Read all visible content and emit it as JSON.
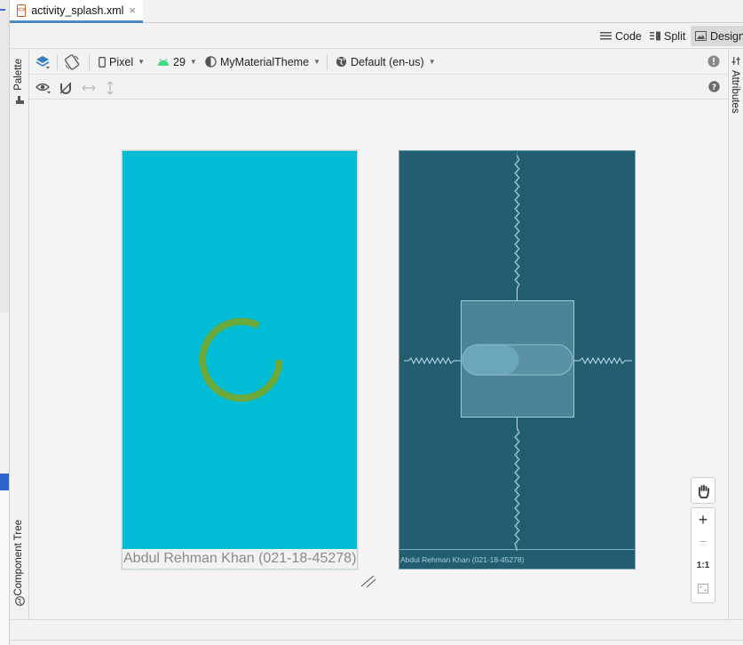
{
  "editor_tab": {
    "file_icon": "xml-file-icon",
    "file_icon_text": "<>",
    "filename": "activity_splash.xml",
    "close_glyph": "×"
  },
  "mode_bar": {
    "code_label": "Code",
    "split_label": "Split",
    "design_label": "Design",
    "active": "Design"
  },
  "side_panels": {
    "palette_label": "Palette",
    "component_tree_label": "Component Tree",
    "attributes_label": "Attributes"
  },
  "toolbar": {
    "device": "Pixel",
    "api_level": "29",
    "theme": "MyMaterialTheme",
    "locale": "Default (en-us)"
  },
  "design_preview": {
    "background_color": "#00bcd4",
    "spinner_color": "#6aaa3c",
    "footer_text": "Abdul Rehman Khan (021-18-45278)"
  },
  "blueprint_preview": {
    "background_color": "#235d70",
    "footer_text": "Abdul Rehman Khan (021-18-45278)"
  },
  "zoom_controls": {
    "pan_icon": "hand-icon",
    "zoom_in": "+",
    "zoom_out": "−",
    "actual_size": "1:1",
    "fit_icon": "fit-screen-icon"
  }
}
